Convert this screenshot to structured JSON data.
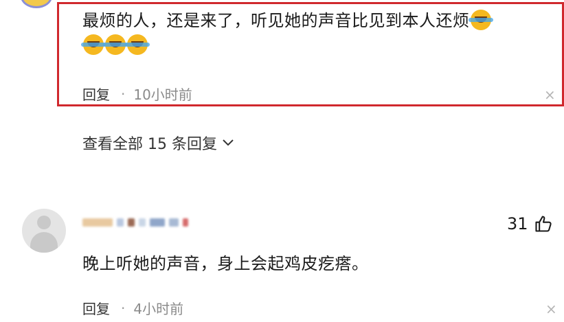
{
  "comment_1": {
    "text": "最烦的人，还是来了，听见她的声音比见到本人还烦",
    "reply_label": "回复",
    "separator": "·",
    "time": "10小时前",
    "close_symbol": "×"
  },
  "view_all_replies": {
    "label": "查看全部 15 条回复",
    "chevron": "⌄"
  },
  "comment_2": {
    "text": "晚上听她的声音，身上会起鸡皮疙瘩。",
    "like_count": "31",
    "reply_label": "回复",
    "separator": "·",
    "time": "4小时前",
    "close_symbol": "×"
  },
  "colors": {
    "highlight_border": "#d0282d",
    "emoji_face": "#f5b820",
    "meta_time": "#8a8a8a"
  },
  "icons": {
    "emoji": "crying-laughing-emoji-icon",
    "like": "thumbs-up-icon",
    "close": "close-icon",
    "chevron": "chevron-down-icon"
  }
}
